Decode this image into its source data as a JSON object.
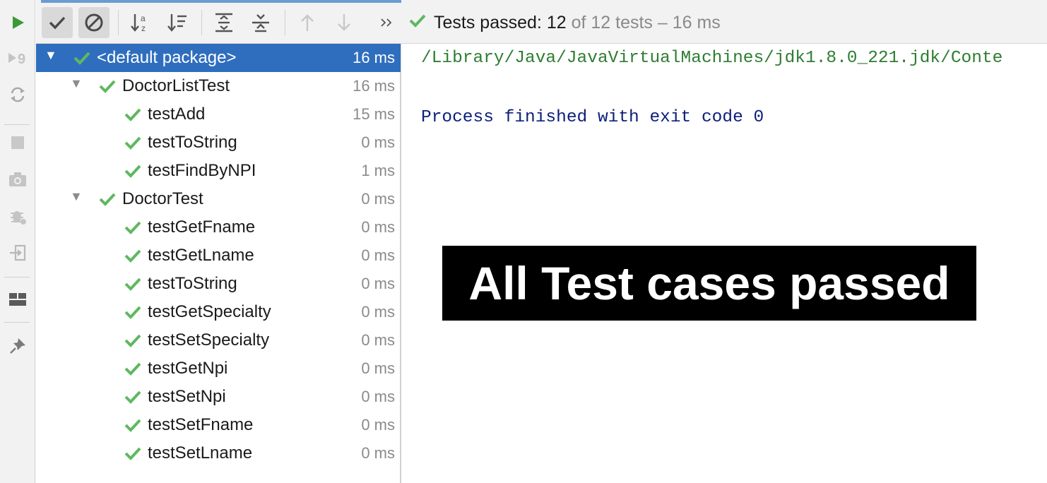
{
  "colors": {
    "accent": "#2f6ebe",
    "success": "#5fb85f",
    "run_green": "#3a9a3a",
    "console_path": "#2e7d32",
    "console_text": "#0c1f7a"
  },
  "left_bar": {
    "icons": [
      "run-icon",
      "rerun-failed-icon",
      "toggle-auto-test-icon",
      "stop-icon",
      "screenshot-icon",
      "debug-icon",
      "exit-icon",
      "layout-icon",
      "pin-icon"
    ]
  },
  "toolbar": {
    "buttons": [
      "show-passed-icon",
      "show-ignored-icon",
      "sort-alphabetically-icon",
      "sort-by-duration-icon",
      "expand-all-icon",
      "collapse-all-icon",
      "previous-failed-icon",
      "next-failed-icon",
      "more-icon"
    ],
    "status": {
      "label": "Tests passed:",
      "passed": "12",
      "total_text": "of 12 tests – 16 ms"
    }
  },
  "tree": {
    "rows": [
      {
        "name": "<default package>",
        "time": "16 ms",
        "level": 0,
        "selected": true,
        "expandable": true
      },
      {
        "name": "DoctorListTest",
        "time": "16 ms",
        "level": 1,
        "selected": false,
        "expandable": true
      },
      {
        "name": "testAdd",
        "time": "15 ms",
        "level": 2,
        "selected": false,
        "expandable": false
      },
      {
        "name": "testToString",
        "time": "0 ms",
        "level": 2,
        "selected": false,
        "expandable": false
      },
      {
        "name": "testFindByNPI",
        "time": "1 ms",
        "level": 2,
        "selected": false,
        "expandable": false
      },
      {
        "name": "DoctorTest",
        "time": "0 ms",
        "level": 1,
        "selected": false,
        "expandable": true
      },
      {
        "name": "testGetFname",
        "time": "0 ms",
        "level": 2,
        "selected": false,
        "expandable": false
      },
      {
        "name": "testGetLname",
        "time": "0 ms",
        "level": 2,
        "selected": false,
        "expandable": false
      },
      {
        "name": "testToString",
        "time": "0 ms",
        "level": 2,
        "selected": false,
        "expandable": false
      },
      {
        "name": "testGetSpecialty",
        "time": "0 ms",
        "level": 2,
        "selected": false,
        "expandable": false
      },
      {
        "name": "testSetSpecialty",
        "time": "0 ms",
        "level": 2,
        "selected": false,
        "expandable": false
      },
      {
        "name": "testGetNpi",
        "time": "0 ms",
        "level": 2,
        "selected": false,
        "expandable": false
      },
      {
        "name": "testSetNpi",
        "time": "0 ms",
        "level": 2,
        "selected": false,
        "expandable": false
      },
      {
        "name": "testSetFname",
        "time": "0 ms",
        "level": 2,
        "selected": false,
        "expandable": false
      },
      {
        "name": "testSetLname",
        "time": "0 ms",
        "level": 2,
        "selected": false,
        "expandable": false
      }
    ]
  },
  "console": {
    "command_line": "/Library/Java/JavaVirtualMachines/jdk1.8.0_221.jdk/Conte",
    "finished_line": "Process finished with exit code 0"
  },
  "banner": {
    "text": "All Test cases passed"
  }
}
